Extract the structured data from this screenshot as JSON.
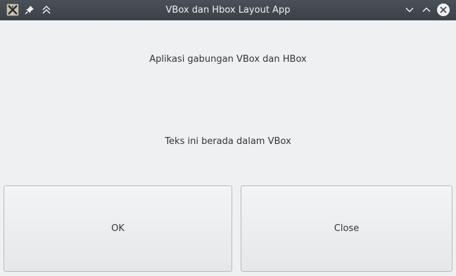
{
  "window": {
    "title": "VBox dan Hbox Layout App",
    "icons": {
      "app": "app-logo-icon",
      "pin": "pin-icon",
      "keep_above": "keep-above-icon",
      "minimize": "minimize-icon",
      "maximize": "maximize-icon",
      "close": "close-icon"
    }
  },
  "content": {
    "header_label": "Aplikasi gabungan VBox dan HBox",
    "vbox_label": "Teks ini berada dalam VBox"
  },
  "buttons": {
    "ok_label": "OK",
    "close_label": "Close"
  },
  "colors": {
    "titlebar": "#3f444a",
    "background": "#eff0f1",
    "text": "#31363b"
  }
}
